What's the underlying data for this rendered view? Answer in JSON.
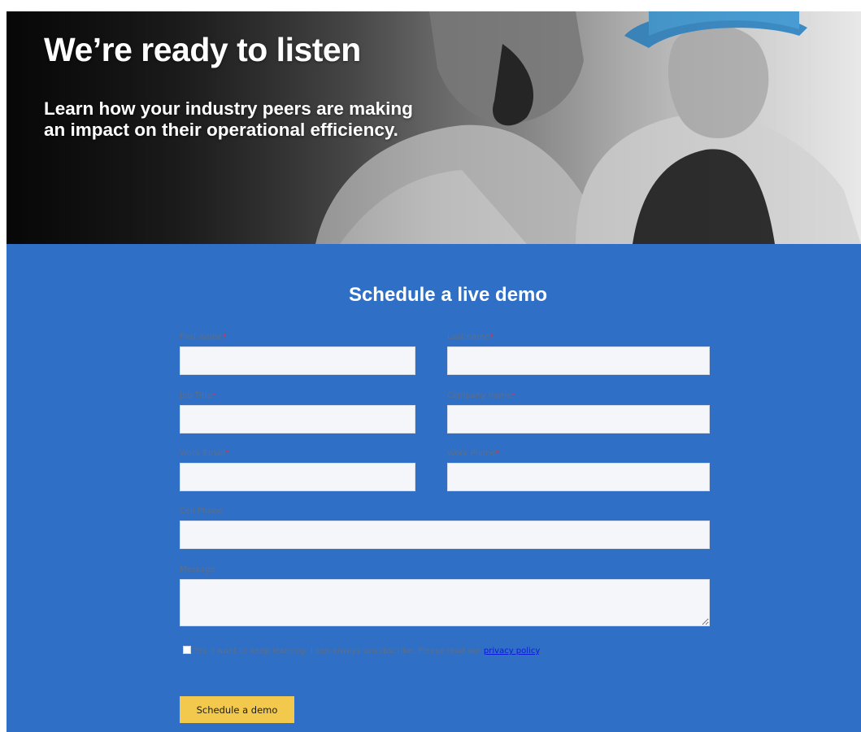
{
  "hero": {
    "title": "We’re ready to listen",
    "subtitle": "Learn how your industry peers are making an impact on their operational efficiency."
  },
  "form": {
    "title": "Schedule a live demo",
    "required_marker": "*",
    "fields": {
      "first_name": {
        "label": "First name",
        "value": "",
        "placeholder": ""
      },
      "last_name": {
        "label": "Last name",
        "value": "",
        "placeholder": ""
      },
      "job_title": {
        "label": "Job Title",
        "value": "",
        "placeholder": ""
      },
      "company_name": {
        "label": "Company name",
        "value": "",
        "placeholder": ""
      },
      "work_email": {
        "label": "Work Email",
        "value": "",
        "placeholder": ""
      },
      "work_phone": {
        "label": "Work Phone",
        "value": "",
        "placeholder": ""
      },
      "cell_phone": {
        "label": "Cell Phone",
        "value": "",
        "placeholder": ""
      },
      "message": {
        "label": "Message",
        "value": "",
        "placeholder": ""
      }
    },
    "consent": {
      "checked": false,
      "text": "Yes, I want to keep learning. I can always unsubscribe. Please read our",
      "link_text": "privacy policy",
      "end_text": "."
    },
    "submit_label": "Schedule a demo"
  },
  "colors": {
    "section_background": "#2f6fc6",
    "button_background": "#f2c94c",
    "required_marker": "#e03434",
    "link": "#0b1ad6",
    "input_background": "#f4f6f9"
  }
}
